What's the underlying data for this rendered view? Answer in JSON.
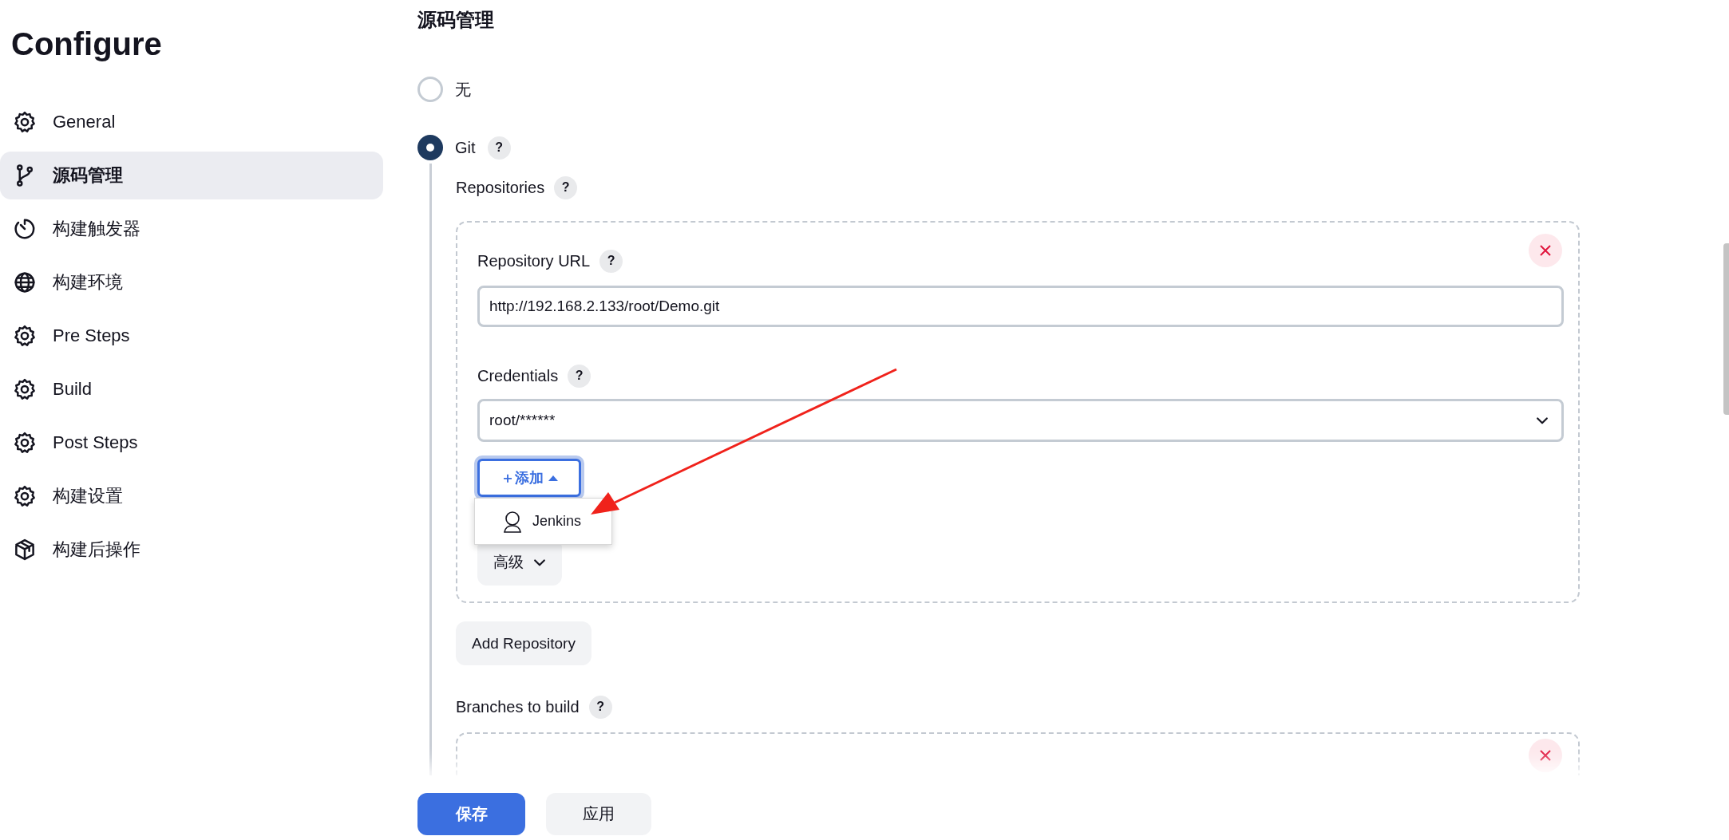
{
  "sidebar": {
    "title": "Configure",
    "items": [
      {
        "label": "General",
        "kind": "settings",
        "selected": false
      },
      {
        "label": "源码管理",
        "kind": "branch",
        "selected": true
      },
      {
        "label": "构建触发器",
        "kind": "timer",
        "selected": false
      },
      {
        "label": "构建环境",
        "kind": "globe",
        "selected": false
      },
      {
        "label": "Pre Steps",
        "kind": "settings",
        "selected": false
      },
      {
        "label": "Build",
        "kind": "settings",
        "selected": false
      },
      {
        "label": "Post Steps",
        "kind": "settings",
        "selected": false
      },
      {
        "label": "构建设置",
        "kind": "settings",
        "selected": false
      },
      {
        "label": "构建后操作",
        "kind": "package",
        "selected": false
      }
    ]
  },
  "section": {
    "title": "源码管理",
    "options": [
      {
        "label": "无",
        "selected": false
      },
      {
        "label": "Git",
        "selected": true,
        "help": "?"
      }
    ]
  },
  "git": {
    "repositories_label": "Repositories",
    "repositories_help": "?",
    "repository": {
      "url_label": "Repository URL",
      "url_help": "?",
      "url_value": "http://192.168.2.133/root/Demo.git",
      "credentials_label": "Credentials",
      "credentials_help": "?",
      "credentials_value": "root/******",
      "add_button": {
        "label": "＋添加",
        "expanded": true
      },
      "add_menu": [
        {
          "label": "Jenkins"
        }
      ],
      "advanced_button": "高级"
    },
    "add_repository_button": "Add Repository",
    "branches_label": "Branches to build",
    "branches_help": "?"
  },
  "footer": {
    "buttons": [
      {
        "label": "保存",
        "kind": "primary"
      },
      {
        "label": "应用",
        "kind": "secondary"
      }
    ]
  }
}
